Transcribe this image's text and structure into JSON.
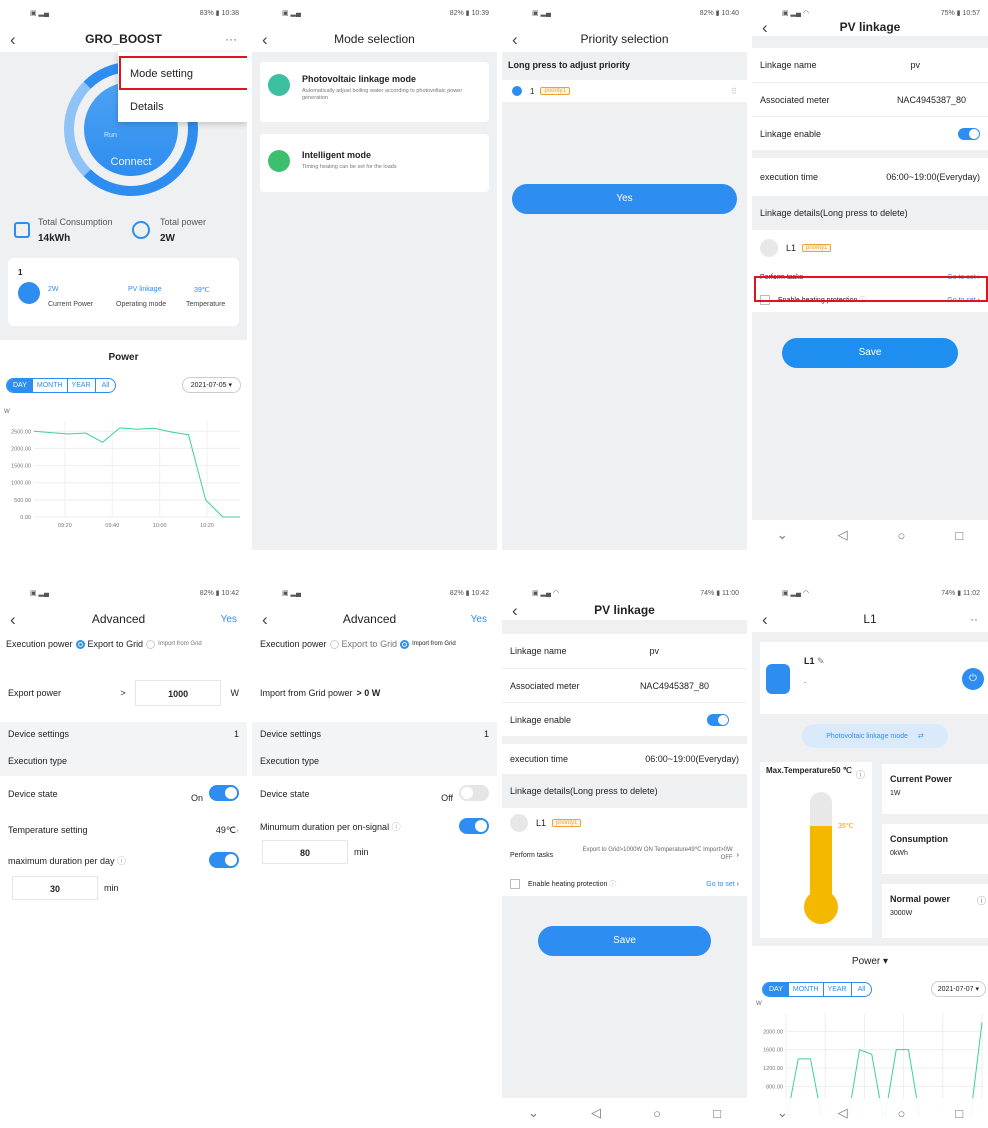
{
  "status": {
    "s1": "10:38",
    "s1b": "83%",
    "s2": "10:39",
    "s2b": "82%",
    "s3": "10:40",
    "s3b": "82%",
    "s4": "10:57",
    "s4b": "75%",
    "s5": "10:42",
    "s5b": "82%",
    "s6": "10:42",
    "s6b": "82%",
    "s7": "11:00",
    "s7b": "74%",
    "s8": "11:02",
    "s8b": "74%"
  },
  "p1": {
    "title": "GRO_BOOST",
    "menu": [
      "Mode setting",
      "Details"
    ],
    "ring_run": "Run",
    "ring_btn": "Connect",
    "tc_label": "Total Consumption",
    "tc_val": "14kWh",
    "tp_label": "Total power",
    "tp_val": "2W",
    "dev_num": "1",
    "dev_power": "2W",
    "dev_mode": "PV linkage",
    "dev_temp": "39℃",
    "dev_l1": "Current Power",
    "dev_l2": "Operating mode",
    "dev_l3": "Temperature",
    "chart_title": "Power",
    "tabs": [
      "DAY",
      "MONTH",
      "YEAR",
      "All"
    ],
    "date": "2021-07-05"
  },
  "chart_data": [
    {
      "type": "line",
      "title": "Power",
      "ylabel": "W",
      "x": [
        "09:20",
        "09:40",
        "10:00",
        "10:20"
      ],
      "yticks": [
        "2500.00",
        "2000.00",
        "1500.00",
        "1000.00",
        "500.00",
        "0.00"
      ],
      "ylim": [
        0,
        2800
      ],
      "series": [
        {
          "values": [
            2500,
            2460,
            2420,
            2450,
            2180,
            2600,
            2560,
            2590,
            2480,
            2400,
            500,
            0,
            0
          ]
        }
      ]
    },
    {
      "type": "line",
      "ylabel": "W",
      "yticks": [
        "2000.00",
        "1600.00",
        "1200.00",
        "800.00"
      ],
      "ylim": [
        0,
        2400
      ],
      "series": [
        {
          "values": [
            0,
            1400,
            1400,
            0,
            0,
            0,
            1600,
            1500,
            0,
            1600,
            1600,
            0,
            0,
            0,
            0,
            0,
            2200
          ]
        }
      ]
    }
  ],
  "p2": {
    "title": "Mode selection",
    "m1_title": "Photovoltaic linkage mode",
    "m1_desc": "Automatically adjust boiling water according to photovoltaic power generation",
    "m2_title": "Intelligent mode",
    "m2_desc": "Timing heating can be set for the loads"
  },
  "p3": {
    "title": "Priority selection",
    "hint": "Long press to adjust priority",
    "item_num": "1",
    "item_tag": "priority1",
    "yes": "Yes"
  },
  "p4": {
    "title": "PV linkage",
    "name_l": "Linkage name",
    "name_v": "pv",
    "meter_l": "Associated meter",
    "meter_v": "NAC4945387_80",
    "enable_l": "Linkage enable",
    "time_l": "execution time",
    "time_v": "06:00~19:00(Everyday)",
    "details": "Linkage details(Long press to delete)",
    "l1": "L1",
    "l1_tag": "priority1",
    "perform": "Perform tasks",
    "goto": "Go to set",
    "protect": "Enable heating protection",
    "save": "Save"
  },
  "p5": {
    "title": "Advanced",
    "yes": "Yes",
    "exec": "Execution power",
    "export": "Export to Grid",
    "import": "Import from Grid",
    "export_power": "Export power",
    "gt": ">",
    "ep_val": "1000",
    "ep_unit": "W",
    "dev_settings": "Device settings",
    "dev_count": "1",
    "exec_type": "Execution type",
    "dev_state": "Device state",
    "on": "On",
    "temp_set": "Temperature setting",
    "temp_val": "49℃",
    "max_dur": "maximum duration per day",
    "dur_val": "30",
    "dur_unit": "min"
  },
  "p6": {
    "title": "Advanced",
    "yes": "Yes",
    "exec": "Execution power",
    "export": "Export to Grid",
    "import": "Import from Grid",
    "import_power": "Import from Grid power",
    "import_val": "> 0 W",
    "dev_settings": "Device settings",
    "dev_count": "1",
    "exec_type": "Execution type",
    "dev_state": "Device state",
    "off": "Off",
    "min_dur": "Minumum duration per on-signal",
    "min_val": "80",
    "min_unit": "min"
  },
  "p7": {
    "title": "PV linkage",
    "name_l": "Linkage name",
    "name_v": "pv",
    "meter_l": "Associated meter",
    "meter_v": "NAC4945387_80",
    "enable_l": "Linkage enable",
    "time_l": "execution time",
    "time_v": "06:00~19:00(Everyday)",
    "details": "Linkage details(Long press to delete)",
    "l1": "L1",
    "l1_tag": "priority1",
    "perform": "Perform tasks",
    "task_txt": "Export to Grid>1000W ON Temperature49℃ Import>0W OFF",
    "protect": "Enable heating protection",
    "goto": "Go to set",
    "save": "Save"
  },
  "p8": {
    "title": "L1",
    "dev": "L1",
    "dev_sub": ".",
    "mode": "Photovoltaic linkage mode",
    "maxtemp": "Max.Temperature50 ℃",
    "temp": "35℃",
    "cp_l": "Current Power",
    "cp_v": "1W",
    "cons_l": "Consumption",
    "cons_v": "0kWh",
    "np_l": "Normal power",
    "np_v": "3000W",
    "power": "Power",
    "tabs": [
      "DAY",
      "MONTH",
      "YEAR",
      "All"
    ],
    "date": "2021-07-07"
  }
}
